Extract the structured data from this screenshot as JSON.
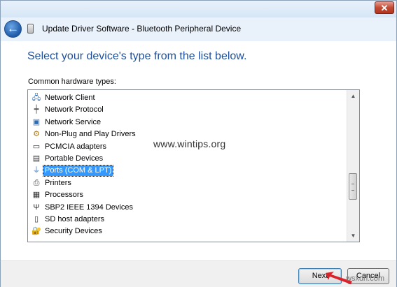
{
  "window": {
    "title": "Update Driver Software - Bluetooth Peripheral Device",
    "close_label": "✕",
    "back_label": "←"
  },
  "content": {
    "heading": "Select your device's type from the list below.",
    "list_label": "Common hardware types:"
  },
  "hardware_types": [
    {
      "label": "Network Client",
      "icon": "network-client-icon",
      "selected": false
    },
    {
      "label": "Network Protocol",
      "icon": "network-protocol-icon",
      "selected": false
    },
    {
      "label": "Network Service",
      "icon": "network-service-icon",
      "selected": false
    },
    {
      "label": "Non-Plug and Play Drivers",
      "icon": "non-pnp-drivers-icon",
      "selected": false
    },
    {
      "label": "PCMCIA adapters",
      "icon": "pcmcia-icon",
      "selected": false
    },
    {
      "label": "Portable Devices",
      "icon": "portable-devices-icon",
      "selected": false
    },
    {
      "label": "Ports (COM & LPT)",
      "icon": "ports-icon",
      "selected": true
    },
    {
      "label": "Printers",
      "icon": "printer-icon",
      "selected": false
    },
    {
      "label": "Processors",
      "icon": "processor-icon",
      "selected": false
    },
    {
      "label": "SBP2 IEEE 1394 Devices",
      "icon": "sbp2-icon",
      "selected": false
    },
    {
      "label": "SD host adapters",
      "icon": "sd-host-icon",
      "selected": false
    },
    {
      "label": "Security Devices",
      "icon": "security-devices-icon",
      "selected": false
    }
  ],
  "watermark": "www.wintips.org",
  "footer": {
    "next_label": "Next",
    "cancel_label": "Cancel"
  },
  "corner_watermark": "wsxdn.com",
  "colors": {
    "heading": "#1e4f9c",
    "selection": "#3399ff",
    "arrow": "#d9222a"
  }
}
